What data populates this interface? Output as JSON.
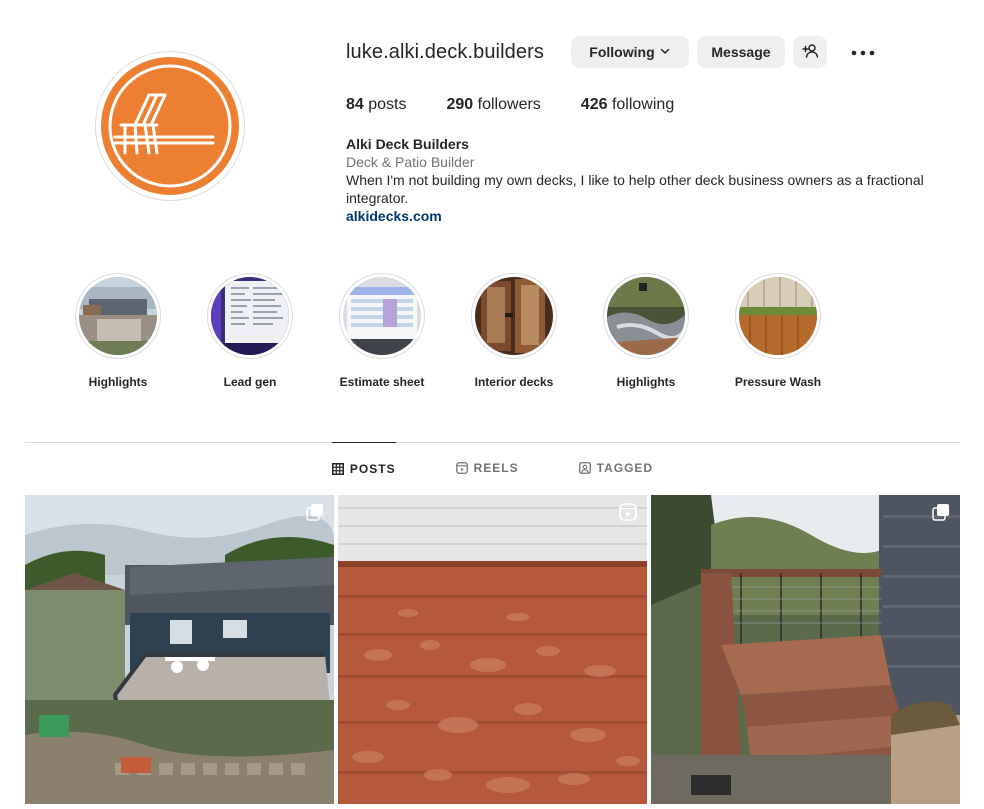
{
  "profile": {
    "username": "luke.alki.deck.builders",
    "following_label": "Following",
    "message_label": "Message",
    "avatar_icon": "deck-logo-icon",
    "brand_color": "#ec7f31",
    "stats": {
      "posts_count": "84",
      "posts_label": "posts",
      "followers_count": "290",
      "followers_label": "followers",
      "following_count": "426",
      "following_label": "following"
    },
    "bio": {
      "name": "Alki Deck Builders",
      "category": "Deck & Patio Builder",
      "text": "When I'm not building my own decks, I like to help other deck business owners as a fractional integrator.",
      "link": "alkidecks.com"
    }
  },
  "highlights": [
    {
      "label": "Highlights"
    },
    {
      "label": "Lead gen"
    },
    {
      "label": "Estimate sheet"
    },
    {
      "label": "Interior decks"
    },
    {
      "label": "Highlights"
    },
    {
      "label": "Pressure Wash"
    }
  ],
  "tabs": [
    {
      "label": "POSTS",
      "icon": "grid-icon",
      "active": true
    },
    {
      "label": "REELS",
      "icon": "reels-icon",
      "active": false
    },
    {
      "label": "TAGGED",
      "icon": "tagged-icon",
      "active": false
    }
  ],
  "posts": [
    {
      "type": "carousel",
      "badge_icon": "carousel-icon"
    },
    {
      "type": "reel",
      "badge_icon": "reel-icon"
    },
    {
      "type": "carousel",
      "badge_icon": "carousel-icon"
    }
  ]
}
